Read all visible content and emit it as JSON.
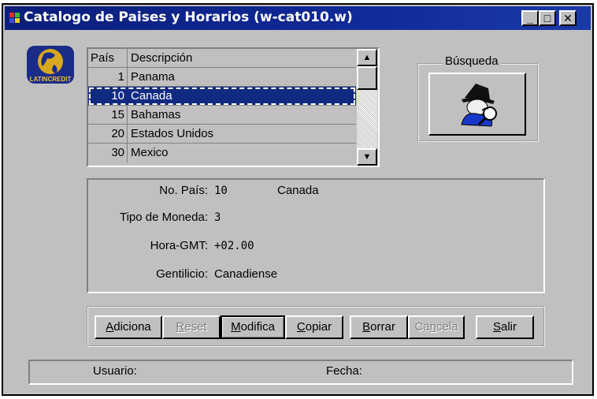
{
  "window": {
    "title": "Catalogo de Paises y Horarios (w-cat010.w)",
    "minimize_glyph": "_",
    "maximize_glyph": "□",
    "close_glyph": "✕"
  },
  "logo": {
    "text": "LATINCREDIT",
    "icon": "globe-logo-icon"
  },
  "grid": {
    "headers": [
      "País",
      "Descripción"
    ],
    "rows": [
      {
        "id": "1",
        "name": "Panama"
      },
      {
        "id": "10",
        "name": "Canada"
      },
      {
        "id": "15",
        "name": "Bahamas"
      },
      {
        "id": "20",
        "name": "Estados Unidos"
      },
      {
        "id": "30",
        "name": "Mexico"
      }
    ],
    "selected_index": 1,
    "scroll_up_glyph": "▲",
    "scroll_down_glyph": "▼"
  },
  "search": {
    "label": "Búsqueda",
    "icon": "detective-magnifier-icon"
  },
  "detail": {
    "pais_label": "No. País:",
    "pais_id": "10",
    "pais_name": "Canada",
    "moneda_label": "Tipo de Moneda:",
    "moneda_value": "3",
    "gmt_label": "Hora-GMT:",
    "gmt_value": "+02.00",
    "gentilicio_label": "Gentilicio:",
    "gentilicio_value": "Canadiense"
  },
  "buttons": {
    "adiciona": {
      "u": "A",
      "rest": "diciona"
    },
    "reset": {
      "u": "R",
      "rest": "eset"
    },
    "modifica": {
      "u": "M",
      "rest": "odifica"
    },
    "copiar": {
      "u": "C",
      "rest": "opiar"
    },
    "borrar": {
      "u": "B",
      "rest": "orrar"
    },
    "cancela": {
      "pre": "Ca",
      "u": "n",
      "rest": "cela"
    },
    "salir": {
      "u": "S",
      "rest": "alir"
    }
  },
  "status": {
    "usuario_label": "Usuario:",
    "fecha_label": "Fecha:"
  },
  "colors": {
    "titlebar": "#0a1e7a",
    "selection": "#102a80",
    "face": "#c0c0c0"
  }
}
